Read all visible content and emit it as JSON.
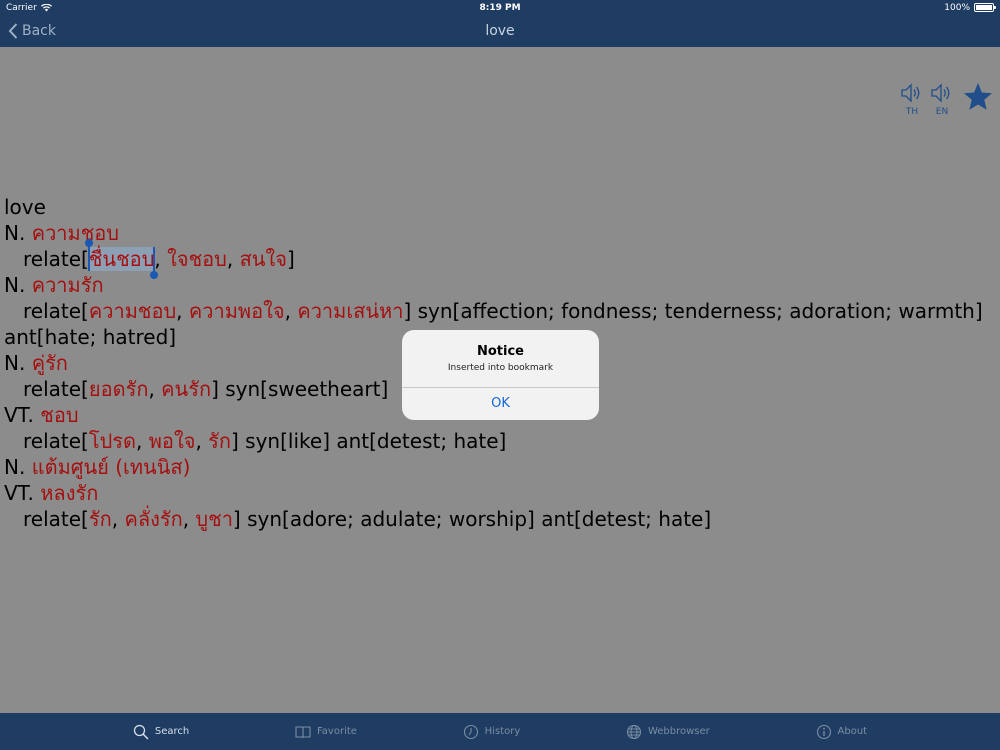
{
  "status": {
    "carrier": "Carrier",
    "time": "8:19 PM",
    "battery": "100%"
  },
  "nav": {
    "back_label": "Back",
    "title": "love"
  },
  "speakers": {
    "th_label": "TH",
    "en_label": "EN"
  },
  "entry": {
    "headword": "love",
    "l1_pos": "N.",
    "l1_th": "ความชอบ",
    "l2_relate": "relate[",
    "l2_sel": "ชื่นชอบ",
    "l2_c1": ", ",
    "l2_t2": "ใจชอบ",
    "l2_c2": ", ",
    "l2_t3": "สนใจ",
    "l2_end": "]",
    "l3_pos": "N.",
    "l3_th": "ความรัก",
    "l4_relate": "relate[",
    "l4_t1": "ความชอบ",
    "l4_c1": ", ",
    "l4_t2": "ความพอใจ",
    "l4_c2": ", ",
    "l4_t3": "ความเสน่หา",
    "l4_end": "] syn[affection; fondness; tenderness; adoration; warmth]",
    "l5": "ant[hate; hatred]",
    "l6_pos": "N.",
    "l6_th": "คู่รัก",
    "l7_relate": "relate[",
    "l7_t1": "ยอดรัก",
    "l7_c1": ", ",
    "l7_t2": "คนรัก",
    "l7_end": "] syn[sweetheart]",
    "l8_pos": "VT.",
    "l8_th": "ชอบ",
    "l9_relate": "relate[",
    "l9_t1": "โปรด",
    "l9_c1": ", ",
    "l9_t2": "พอใจ",
    "l9_c2": ", ",
    "l9_t3": "รัก",
    "l9_end": "] syn[like] ant[detest; hate]",
    "l10_pos": "N.",
    "l10_th": "แต้มศูนย์ (เทนนิส)",
    "l11_pos": "VT.",
    "l11_th": "หลงรัก",
    "l12_relate": "relate[",
    "l12_t1": "รัก",
    "l12_c1": ", ",
    "l12_t2": "คลั่งรัก",
    "l12_c2": ", ",
    "l12_t3": "บูชา",
    "l12_end": "] syn[adore; adulate; worship] ant[detest; hate]"
  },
  "alert": {
    "title": "Notice",
    "message": "Inserted into bookmark",
    "ok_label": "OK"
  },
  "tabs": [
    {
      "label": "Search",
      "icon": "search-icon"
    },
    {
      "label": "Favorite",
      "icon": "book-icon"
    },
    {
      "label": "History",
      "icon": "clock-icon"
    },
    {
      "label": "Webbrowser",
      "icon": "globe-icon"
    },
    {
      "label": "About",
      "icon": "info-icon"
    }
  ],
  "colors": {
    "bar": "#1f3d62",
    "thai": "#a50f0f",
    "accent": "#1f4e8a",
    "dim_bg": "#8c8c8c"
  }
}
